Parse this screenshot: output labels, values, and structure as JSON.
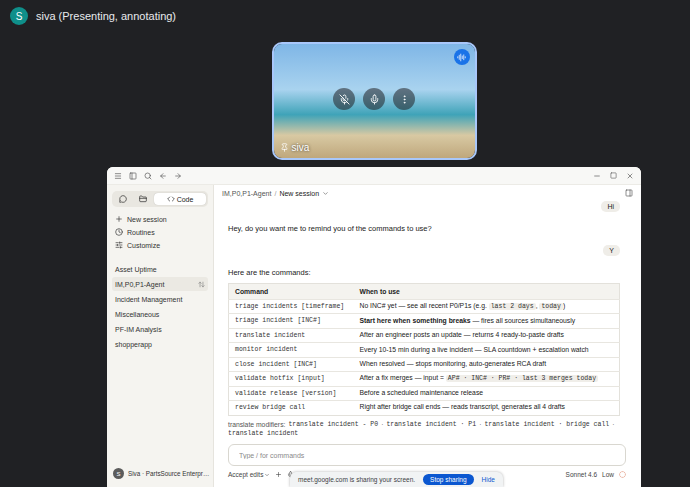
{
  "meet": {
    "presenter": {
      "initial": "S",
      "label": "siva (Presenting, annotating)"
    },
    "tile": {
      "name": "siva"
    }
  },
  "app": {
    "sidebar": {
      "tabs": [
        {
          "kind": "icon",
          "label": "",
          "selected": false
        },
        {
          "kind": "icon",
          "label": "",
          "selected": false
        },
        {
          "kind": "text",
          "label": "Code",
          "selected": true
        }
      ],
      "nav": [
        "New session",
        "Routines",
        "Customize"
      ],
      "projects": [
        {
          "label": "Asset Uptime",
          "selected": false
        },
        {
          "label": "IM,P0,P1-Agent",
          "selected": true
        },
        {
          "label": "Incident Management",
          "selected": false
        },
        {
          "label": "Miscellaneous",
          "selected": false
        },
        {
          "label": "PF-IM Analysis",
          "selected": false
        },
        {
          "label": "shopperapp",
          "selected": false
        }
      ],
      "user": {
        "initial": "S",
        "label": "Siva · PartsSource Enterpr…"
      }
    },
    "header": {
      "project": "IM,P0,P1-Agent",
      "separator": "/",
      "session": "New session"
    },
    "messages": [
      {
        "kind": "user",
        "text": "Hi"
      },
      {
        "kind": "assistant",
        "text": "Hey, do you want me to remind you of the commands to use?"
      },
      {
        "kind": "user",
        "text": "Y"
      },
      {
        "kind": "assistant",
        "text": "Here are the commands:"
      }
    ],
    "table": {
      "columns": [
        "Command",
        "When to use"
      ],
      "rows": [
        {
          "command": "triage incidents [timeframe]",
          "when": [
            {
              "style": "plain",
              "text": "No INC# yet — see all recent P0/P1s (e.g. "
            },
            {
              "style": "code",
              "text": "last 2 days"
            },
            {
              "style": "plain",
              "text": ", "
            },
            {
              "style": "code",
              "text": "today"
            },
            {
              "style": "plain",
              "text": ")"
            }
          ]
        },
        {
          "command": "triage incident [INC#]",
          "when": [
            {
              "style": "bold",
              "text": "Start here when something breaks"
            },
            {
              "style": "plain",
              "text": " — fires all sources simultaneously"
            }
          ]
        },
        {
          "command": "translate incident",
          "when": [
            {
              "style": "plain",
              "text": "After an engineer posts an update — returns 4 ready-to-paste drafts"
            }
          ]
        },
        {
          "command": "monitor incident",
          "when": [
            {
              "style": "plain",
              "text": "Every 10-15 min during a live incident — SLA countdown + escalation watch"
            }
          ]
        },
        {
          "command": "close incident [INC#]",
          "when": [
            {
              "style": "plain",
              "text": "When resolved — stops monitoring, auto-generates RCA draft"
            }
          ]
        },
        {
          "command": "validate hotfix [input]",
          "when": [
            {
              "style": "plain",
              "text": "After a fix merges — input = "
            },
            {
              "style": "code",
              "text": "AP# · INC# · PR# · last 3 merges today"
            }
          ]
        },
        {
          "command": "validate release [version]",
          "when": [
            {
              "style": "plain",
              "text": "Before a scheduled maintenance release"
            }
          ]
        },
        {
          "command": "review bridge call",
          "when": [
            {
              "style": "plain",
              "text": "Right after bridge call ends — reads transcript, generates all 4 drafts"
            }
          ]
        }
      ]
    },
    "modifiers": {
      "label": "translate modifiers:",
      "separator": "·",
      "items": [
        "translate incident - P0",
        "translate incident · P1",
        "translate incident · bridge call",
        "translate incident"
      ]
    },
    "composer": {
      "placeholder": "Type / for commands",
      "mode": "Accept edits",
      "model": "Sonnet 4.6",
      "effort": "Low"
    }
  },
  "share_banner": {
    "text": "meet.google.com is sharing your screen.",
    "stop": "Stop sharing",
    "hide": "Hide"
  }
}
